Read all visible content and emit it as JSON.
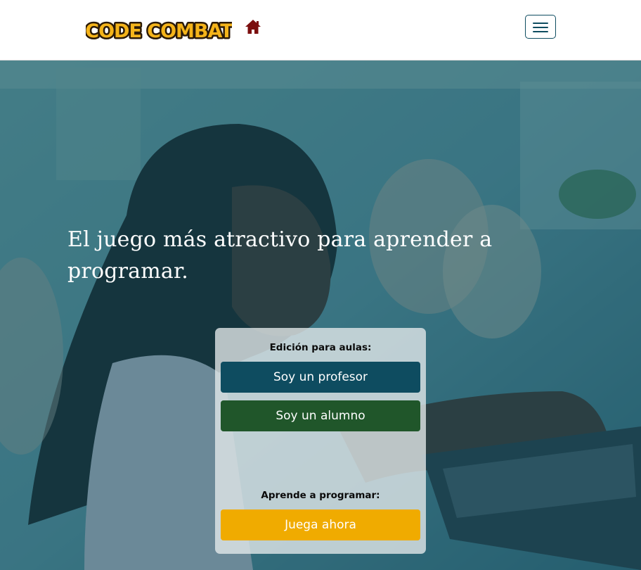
{
  "header": {
    "logo_text": "CODE COMBAT",
    "home_icon": "home-icon",
    "menu_icon": "hamburger-menu-icon"
  },
  "hero": {
    "title": "El juego más atractivo para aprender a programar."
  },
  "signup_panel": {
    "classroom_label": "Edición para aulas:",
    "teacher_button": "Soy un profesor",
    "student_button": "Soy un alumno",
    "learn_label": "Aprende a programar:",
    "play_button": "Juega ahora"
  },
  "colors": {
    "teacher_button": "#0e4c60",
    "student_button": "#20562a",
    "play_button": "#f0ab00",
    "home_icon": "#7b0e0e",
    "hero_overlay": "#125064"
  }
}
